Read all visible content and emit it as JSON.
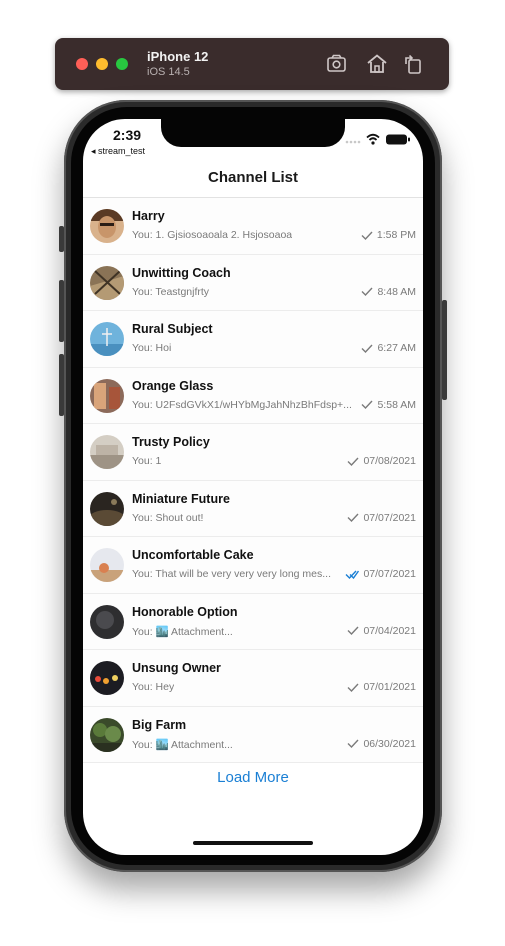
{
  "simulator": {
    "device": "iPhone 12",
    "os": "iOS 14.5",
    "icons": [
      "screenshot-icon",
      "home-icon",
      "rotate-icon"
    ]
  },
  "status_bar": {
    "time": "2:39",
    "back_app": "◂ stream_test",
    "icons": [
      "signal-icon",
      "wifi-icon",
      "battery-icon"
    ]
  },
  "nav": {
    "title": "Channel List"
  },
  "channels": [
    {
      "name": "Harry",
      "preview": "You: 1. Gjsiosoaoala 2. Hsjosoaoa",
      "time": "1:58 PM",
      "read": false
    },
    {
      "name": "Unwitting Coach",
      "preview": "You: Teastgnjfrty",
      "time": "8:48 AM",
      "read": false
    },
    {
      "name": "Rural Subject",
      "preview": "You: Hoi",
      "time": "6:27 AM",
      "read": false
    },
    {
      "name": "Orange Glass",
      "preview": "You: U2FsdGVkX1/wHYbMgJahNhzBhFdsp+...",
      "time": "5:58 AM",
      "read": false
    },
    {
      "name": "Trusty Policy",
      "preview": "You: 1",
      "time": "07/08/2021",
      "read": false
    },
    {
      "name": "Miniature Future",
      "preview": "You: Shout out!",
      "time": "07/07/2021",
      "read": false
    },
    {
      "name": "Uncomfortable Cake",
      "preview": "You: That will be very very very long mes...",
      "time": "07/07/2021",
      "read": true
    },
    {
      "name": "Honorable Option",
      "preview": "You: 🏙️ Attachment...",
      "time": "07/04/2021",
      "read": false
    },
    {
      "name": "Unsung Owner",
      "preview": "You: Hey",
      "time": "07/01/2021",
      "read": false
    },
    {
      "name": "Big Farm",
      "preview": "You: 🏙️ Attachment...",
      "time": "06/30/2021",
      "read": false
    }
  ],
  "load_more": "Load More",
  "colors": {
    "accent": "#1a7fd4",
    "read_check": "#1a7fd4",
    "sent_check": "#7a7a7a",
    "simulator_bar": "#3a2c2c"
  }
}
